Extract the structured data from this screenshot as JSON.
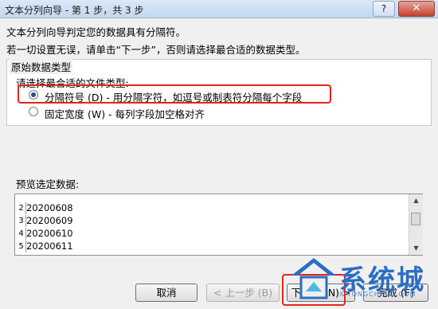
{
  "window": {
    "title": "文本分列向导 - 第 1 步，共 3 步",
    "help_label": "?",
    "close_label": "✕"
  },
  "intro": {
    "line1": "文本分列向导判定您的数据具有分隔符。",
    "line2": "若一切设置无误，请单击“下一步”，否则请选择最合适的数据类型。"
  },
  "original_type_group": {
    "label": "原始数据类型",
    "prompt": "请选择最合适的文件类型:",
    "options": [
      {
        "label": "分隔符号 (D)  - 用分隔字符，如逗号或制表符分隔每个字段",
        "selected": true
      },
      {
        "label": "固定宽度 (W)  - 每列字段加空格对齐",
        "selected": false
      }
    ]
  },
  "preview": {
    "label": "预览选定数据:",
    "rows": [
      {
        "num": "2",
        "value": "20200608"
      },
      {
        "num": "3",
        "value": "20200609"
      },
      {
        "num": "4",
        "value": "20200610"
      },
      {
        "num": "5",
        "value": "20200611"
      }
    ]
  },
  "buttons": {
    "cancel": "取消",
    "back": "< 上一步 (B)",
    "next": "下一步 (N) >",
    "finish": "完成 (F)"
  },
  "watermark": {
    "text": "系统城",
    "sub": "XITONGCHENG.COM"
  },
  "colors": {
    "highlight_box": "#e0261d",
    "watermark_blue": "#2b6ec4"
  }
}
